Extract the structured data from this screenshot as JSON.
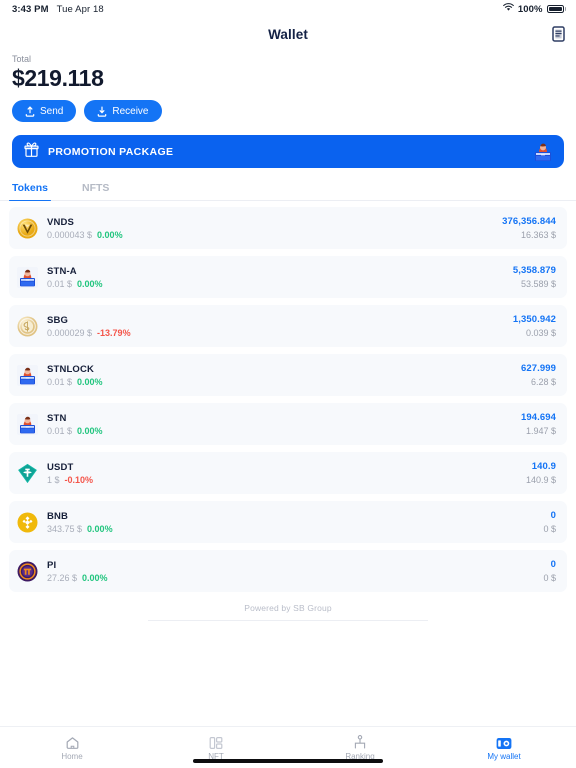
{
  "statusbar": {
    "time": "3:43 PM",
    "date": "Tue Apr 18",
    "battery_percent": "100%",
    "wifi_icon": "wifi-icon",
    "battery_icon": "battery-full-icon"
  },
  "header": {
    "title": "Wallet",
    "action_icon": "document-contract-icon"
  },
  "balance": {
    "total_label": "Total",
    "total_amount": "$219.118",
    "send_label": "Send",
    "send_icon": "upload-arrow-icon",
    "receive_label": "Receive",
    "receive_icon": "download-arrow-icon"
  },
  "promo": {
    "text": "PROMOTION PACKAGE",
    "gift_icon": "gift-box-icon",
    "avatar_icon": "character-avatar-icon",
    "bg_color": "#0a62ef"
  },
  "tabs": [
    {
      "label": "Tokens",
      "active": true
    },
    {
      "label": "NFTS",
      "active": false
    }
  ],
  "tokens": [
    {
      "symbol": "VNDS",
      "price": "0.000043 $",
      "change": "0.00%",
      "change_dir": "up",
      "amount": "376,356.844",
      "value": "16.363 $",
      "icon": "vnds-coin-icon"
    },
    {
      "symbol": "STN-A",
      "price": "0.01 $",
      "change": "0.00%",
      "change_dir": "up",
      "amount": "5,358.879",
      "value": "53.589 $",
      "icon": "stn-character-icon"
    },
    {
      "symbol": "SBG",
      "price": "0.000029 $",
      "change": "-13.79%",
      "change_dir": "down",
      "amount": "1,350.942",
      "value": "0.039 $",
      "icon": "sbg-coin-icon"
    },
    {
      "symbol": "STNLOCK",
      "price": "0.01 $",
      "change": "0.00%",
      "change_dir": "up",
      "amount": "627.999",
      "value": "6.28 $",
      "icon": "stnlock-character-icon"
    },
    {
      "symbol": "STN",
      "price": "0.01 $",
      "change": "0.00%",
      "change_dir": "up",
      "amount": "194.694",
      "value": "1.947 $",
      "icon": "stn-character-icon"
    },
    {
      "symbol": "USDT",
      "price": "1 $",
      "change": "-0.10%",
      "change_dir": "down",
      "amount": "140.9",
      "value": "140.9 $",
      "icon": "usdt-tether-icon"
    },
    {
      "symbol": "BNB",
      "price": "343.75 $",
      "change": "0.00%",
      "change_dir": "up",
      "amount": "0",
      "value": "0 $",
      "icon": "bnb-coin-icon"
    },
    {
      "symbol": "PI",
      "price": "27.26 $",
      "change": "0.00%",
      "change_dir": "up",
      "amount": "0",
      "value": "0 $",
      "icon": "pi-network-icon"
    }
  ],
  "footer": {
    "credit": "Powered by SB Group"
  },
  "bottomnav": [
    {
      "label": "Home",
      "icon": "home-icon",
      "active": false
    },
    {
      "label": "NFT",
      "icon": "nft-grid-icon",
      "active": false
    },
    {
      "label": "Ranking",
      "icon": "ranking-chart-icon",
      "active": false
    },
    {
      "label": "My wallet",
      "icon": "wallet-icon",
      "active": true
    }
  ],
  "colors": {
    "accent": "#1474f5",
    "promo": "#0a62ef",
    "up": "#21c57e",
    "down": "#f4554a",
    "title": "#132145"
  }
}
